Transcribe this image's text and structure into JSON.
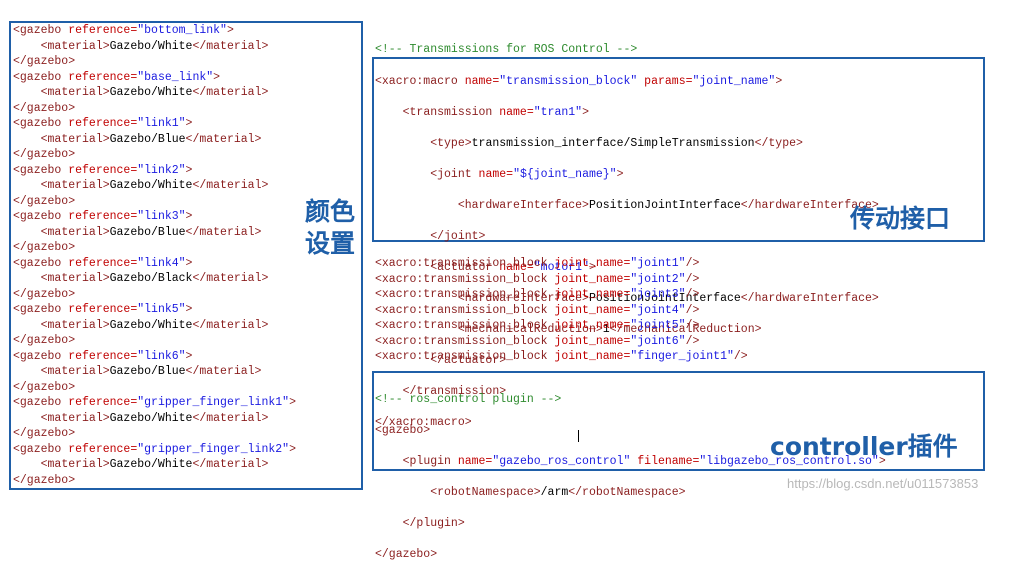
{
  "colors": {
    "tag": "#8a1d1d",
    "attr": "#c00000",
    "value": "#1a1ae0",
    "comment": "#2e8b2e",
    "box": "#1f5fa8"
  },
  "labels": {
    "color_setting_line1": "颜色",
    "color_setting_line2": "设置",
    "transmission": "传动接口",
    "controller": "controller插件"
  },
  "watermark": "https://blog.csdn.net/u011573853",
  "gazebo_colors": {
    "blocks": [
      {
        "ref": "\"bottom_link\"",
        "material": "Gazebo/White"
      },
      {
        "ref": "\"base_link\"",
        "material": "Gazebo/White"
      },
      {
        "ref": "\"link1\"",
        "material": "Gazebo/Blue"
      },
      {
        "ref": "\"link2\"",
        "material": "Gazebo/White"
      },
      {
        "ref": "\"link3\"",
        "material": "Gazebo/Blue"
      },
      {
        "ref": "\"link4\"",
        "material": "Gazebo/Black"
      },
      {
        "ref": "\"link5\"",
        "material": "Gazebo/White"
      },
      {
        "ref": "\"link6\"",
        "material": "Gazebo/Blue"
      },
      {
        "ref": "\"gripper_finger_link1\"",
        "material": "Gazebo/White"
      },
      {
        "ref": "\"gripper_finger_link2\"",
        "material": "Gazebo/White"
      }
    ]
  },
  "transmission_comment": "<!-- Transmissions for ROS Control -->",
  "transmission_macro": {
    "l1_tag": "<xacro:macro",
    "l1_attr1": " name=",
    "l1_val1": "\"transmission_block\"",
    "l1_attr2": " params=",
    "l1_val2": "\"joint_name\"",
    "l1_close": ">",
    "l2_tag": "<transmission",
    "l2_attr": " name=",
    "l2_val": "\"tran1\"",
    "l2_close": ">",
    "l3_open": "<type>",
    "l3_text": "transmission_interface/SimpleTransmission",
    "l3_close": "</type>",
    "l4_tag": "<joint",
    "l4_attr": " name=",
    "l4_val": "\"${joint_name}\"",
    "l4_close": ">",
    "l5_open": "<hardwareInterface>",
    "l5_text": "PositionJointInterface",
    "l5_close": "</hardwareInterface>",
    "l6": "</joint>",
    "l7_tag": "<actuator",
    "l7_attr": " name=",
    "l7_val": "\"motor1\"",
    "l7_close": ">",
    "l8_open": "<hardwareInterface>",
    "l8_text": "PositionJointInterface",
    "l8_close": "</hardwareInterface>",
    "l9_open": "<mechanicalReduction>",
    "l9_text": "1",
    "l9_close": "</mechanicalReduction>",
    "l10": "</actuator>",
    "l11": "</transmission>",
    "l12": "</xacro:macro>"
  },
  "transmission_calls": [
    "\"joint1\"",
    "\"joint2\"",
    "\"joint3\"",
    "\"joint4\"",
    "\"joint5\"",
    "\"joint6\"",
    "\"finger_joint1\""
  ],
  "transmission_call_tag": "<xacro:transmission_block",
  "transmission_call_attr": " joint_name=",
  "transmission_call_close": "/>",
  "plugin": {
    "comment": "<!-- ros_control plugin -->",
    "open": "<gazebo>",
    "p_tag": "<plugin",
    "p_attr1": " name=",
    "p_val1": "\"gazebo_ros_control\"",
    "p_attr2": " filename=",
    "p_val2": "\"libgazebo_ros_control.so\"",
    "p_close": ">",
    "ns_open": "<robotNamespace>",
    "ns_text": "/arm",
    "ns_close": "</robotNamespace>",
    "p_end": "</plugin>",
    "close": "</gazebo>"
  },
  "gazebo_open_tag": "<gazebo",
  "gazebo_ref_attr": " reference=",
  "gazebo_close_tag": "</gazebo>",
  "material_open": "<material>",
  "material_close": "</material>"
}
